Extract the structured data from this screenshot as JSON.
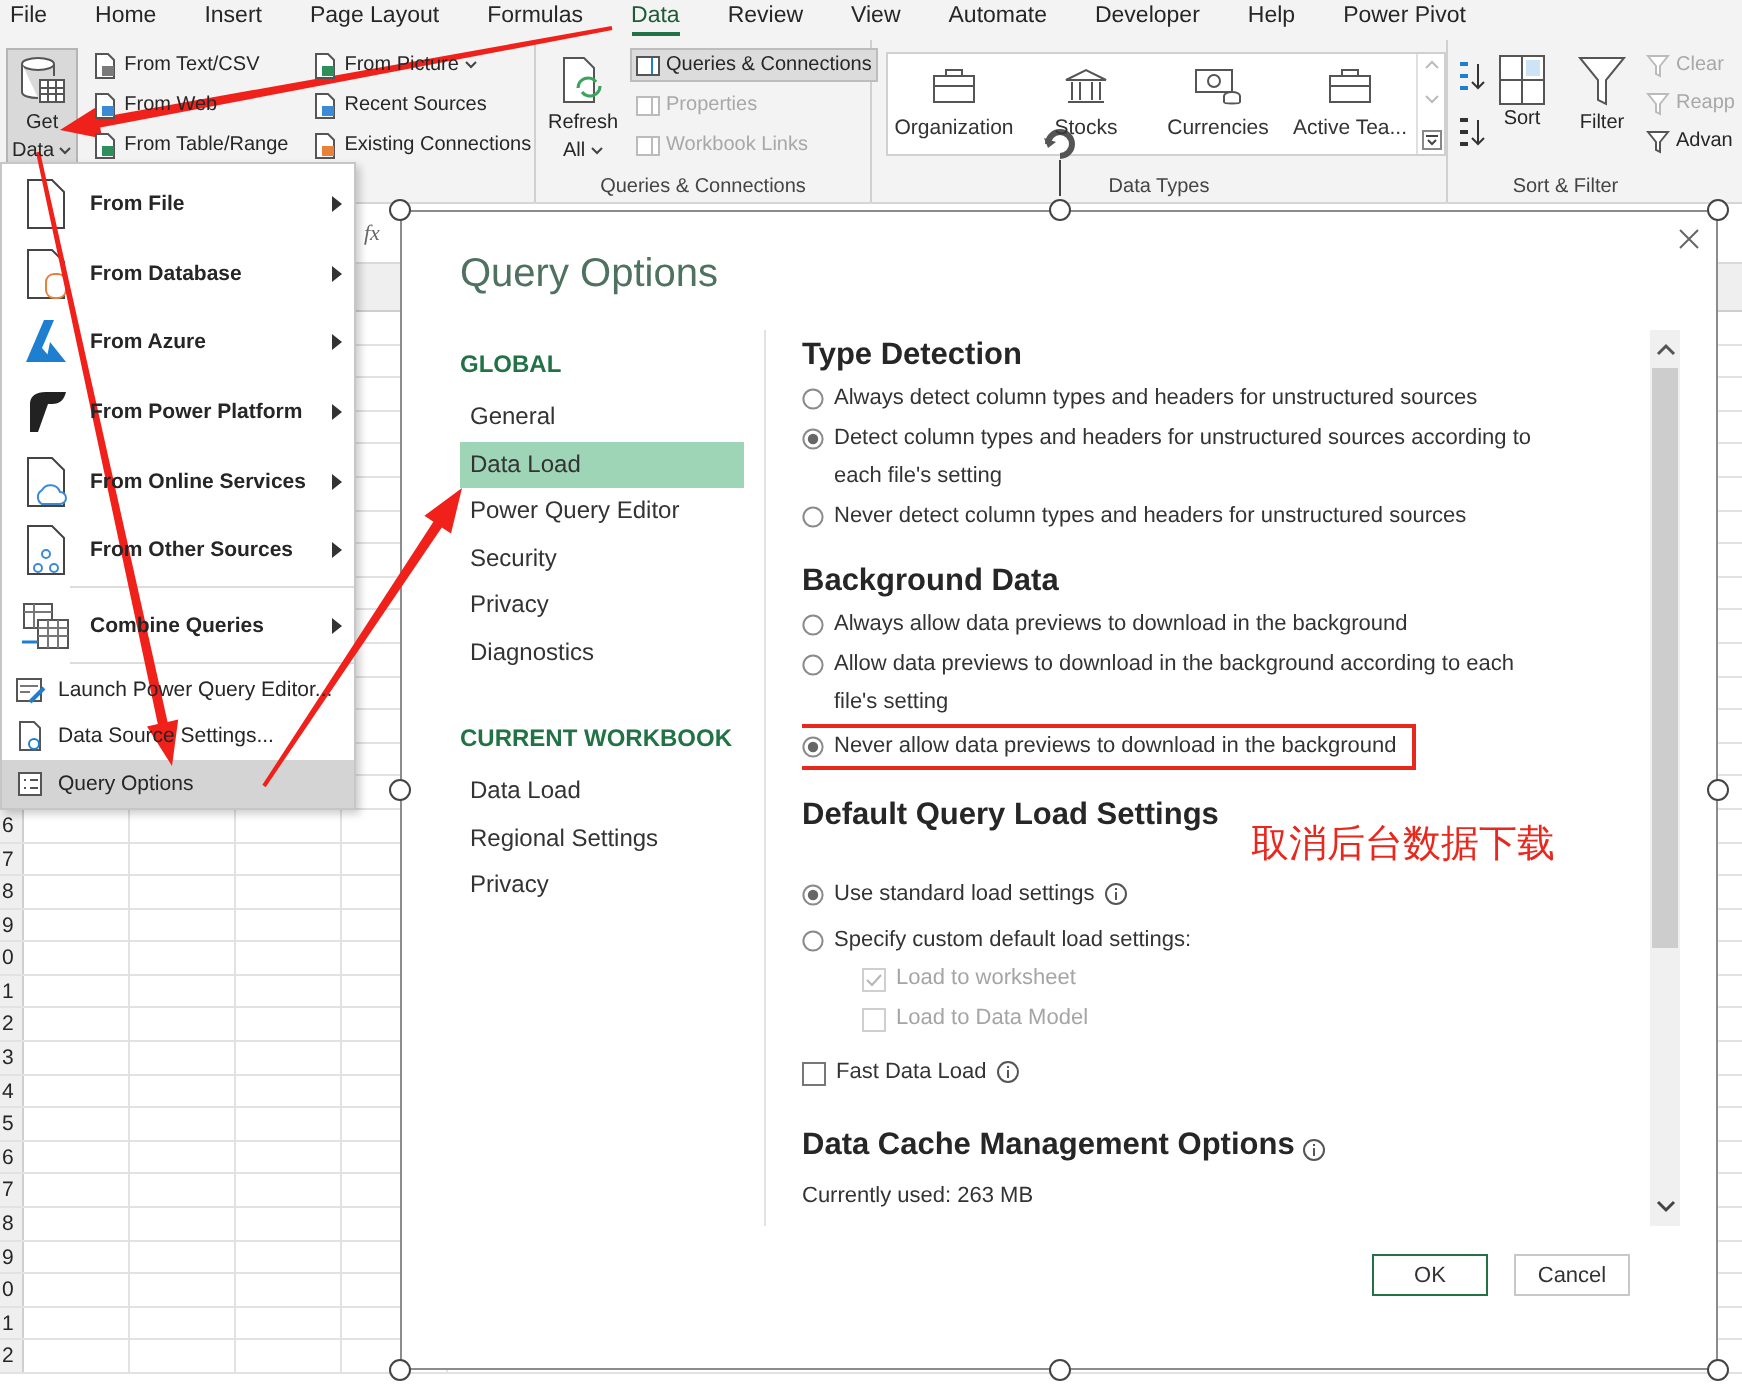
{
  "ribbon_tabs": [
    {
      "label": "File",
      "selected": false
    },
    {
      "label": "Home",
      "selected": false
    },
    {
      "label": "Insert",
      "selected": false
    },
    {
      "label": "Page Layout",
      "selected": false
    },
    {
      "label": "Formulas",
      "selected": false
    },
    {
      "label": "Data",
      "selected": true
    },
    {
      "label": "Review",
      "selected": false
    },
    {
      "label": "View",
      "selected": false
    },
    {
      "label": "Automate",
      "selected": false
    },
    {
      "label": "Developer",
      "selected": false
    },
    {
      "label": "Help",
      "selected": false
    },
    {
      "label": "Power Pivot",
      "selected": false
    }
  ],
  "ribbon": {
    "get_data": {
      "lines": [
        "Get",
        "Data"
      ],
      "open": true
    },
    "get_columns": [
      {
        "items": [
          {
            "label": "From Text/CSV",
            "dropdown": false
          },
          {
            "label": "From Web",
            "dropdown": false
          },
          {
            "label": "From Table/Range",
            "dropdown": false
          }
        ]
      },
      {
        "items": [
          {
            "label": "From Picture",
            "dropdown": true
          },
          {
            "label": "Recent Sources",
            "dropdown": false
          },
          {
            "label": "Existing Connections",
            "dropdown": false
          }
        ]
      }
    ],
    "queries": {
      "refresh_lines": [
        "Refresh",
        "All"
      ],
      "items": [
        {
          "label": "Queries & Connections",
          "selected": true,
          "disabled": false
        },
        {
          "label": "Properties",
          "selected": false,
          "disabled": true
        },
        {
          "label": "Workbook Links",
          "selected": false,
          "disabled": true
        }
      ],
      "group_label": "Queries & Connections"
    },
    "data_types": {
      "items": [
        {
          "label": "Organization"
        },
        {
          "label": "Stocks"
        },
        {
          "label": "Currencies"
        },
        {
          "label": "Active Tea..."
        }
      ],
      "group_label": "Data Types"
    },
    "sort_filter": {
      "sort": "Sort",
      "filter": "Filter",
      "items": [
        {
          "label": "Clear",
          "disabled": true
        },
        {
          "label": "Reapp",
          "disabled": true
        },
        {
          "label": "Advan",
          "disabled": false
        }
      ],
      "group_label": "Sort & Filter"
    }
  },
  "formula_bar": {
    "function_label": "fx"
  },
  "sheet": {
    "row_numbers": [
      "6",
      "7",
      "8",
      "9",
      "0",
      "1",
      "2",
      "3",
      "4",
      "5",
      "6",
      "7",
      "8",
      "9",
      "0",
      "1",
      "2"
    ]
  },
  "get_data_menu": {
    "items": [
      {
        "kind": "large",
        "label": "From File",
        "submenu": true,
        "selected": false
      },
      {
        "kind": "large",
        "label": "From Database",
        "submenu": true,
        "selected": false
      },
      {
        "kind": "large",
        "label": "From Azure",
        "submenu": true,
        "selected": false
      },
      {
        "kind": "large",
        "label": "From Power Platform",
        "submenu": true,
        "selected": false
      },
      {
        "kind": "large",
        "label": "From Online Services",
        "submenu": true,
        "selected": false
      },
      {
        "kind": "large",
        "label": "From Other Sources",
        "submenu": true,
        "selected": false
      },
      {
        "kind": "large",
        "label": "Combine Queries",
        "submenu": true,
        "selected": false
      },
      {
        "kind": "small",
        "label": "Launch Power Query Editor...",
        "submenu": false,
        "selected": false
      },
      {
        "kind": "small",
        "label": "Data Source Settings...",
        "submenu": false,
        "selected": false
      },
      {
        "kind": "small",
        "label": "Query Options",
        "submenu": false,
        "selected": true
      }
    ]
  },
  "dialog": {
    "title": "Query Options",
    "nav": [
      {
        "heading": "GLOBAL",
        "items": [
          {
            "label": "General",
            "selected": false
          },
          {
            "label": "Data Load",
            "selected": true
          },
          {
            "label": "Power Query Editor",
            "selected": false
          },
          {
            "label": "Security",
            "selected": false
          },
          {
            "label": "Privacy",
            "selected": false
          },
          {
            "label": "Diagnostics",
            "selected": false
          }
        ]
      },
      {
        "heading": "CURRENT WORKBOOK",
        "items": [
          {
            "label": "Data Load",
            "selected": false
          },
          {
            "label": "Regional Settings",
            "selected": false
          },
          {
            "label": "Privacy",
            "selected": false
          }
        ]
      }
    ],
    "sections": [
      {
        "heading": "Type Detection",
        "options": [
          {
            "kind": "radio",
            "label": "Always detect column types and headers for unstructured sources",
            "selected": false
          },
          {
            "kind": "radio",
            "label": "Detect column types and headers for unstructured sources according to each file's setting",
            "selected": true
          },
          {
            "kind": "radio",
            "label": "Never detect column types and headers for unstructured sources",
            "selected": false
          }
        ]
      },
      {
        "heading": "Background Data",
        "options": [
          {
            "kind": "radio",
            "label": "Always allow data previews to download in the background",
            "selected": false
          },
          {
            "kind": "radio",
            "label": "Allow data previews to download in the background according to each file's setting",
            "selected": false
          },
          {
            "kind": "radio",
            "label": "Never allow data previews to download in the background",
            "selected": true,
            "highlighted": true
          }
        ]
      },
      {
        "heading": "Default Query Load Settings",
        "note": "取消后台数据下载",
        "options": [
          {
            "kind": "radio",
            "label": "Use standard load settings",
            "selected": true,
            "info": true
          },
          {
            "kind": "radio",
            "label": "Specify custom default load settings:",
            "selected": false,
            "children": [
              {
                "kind": "checkbox",
                "label": "Load to worksheet",
                "checked": true,
                "disabled": true
              },
              {
                "kind": "checkbox",
                "label": "Load to Data Model",
                "checked": false,
                "disabled": true
              }
            ]
          }
        ]
      },
      {
        "options": [
          {
            "kind": "checkbox",
            "label": "Fast Data Load",
            "checked": false,
            "disabled": false,
            "info": true
          }
        ]
      },
      {
        "heading": "Data Cache Management Options",
        "info": true,
        "options": [
          {
            "kind": "text",
            "label": "Currently used: 263 MB"
          }
        ]
      }
    ],
    "buttons": [
      {
        "label": "OK",
        "default": true
      },
      {
        "label": "Cancel",
        "default": false
      }
    ]
  }
}
